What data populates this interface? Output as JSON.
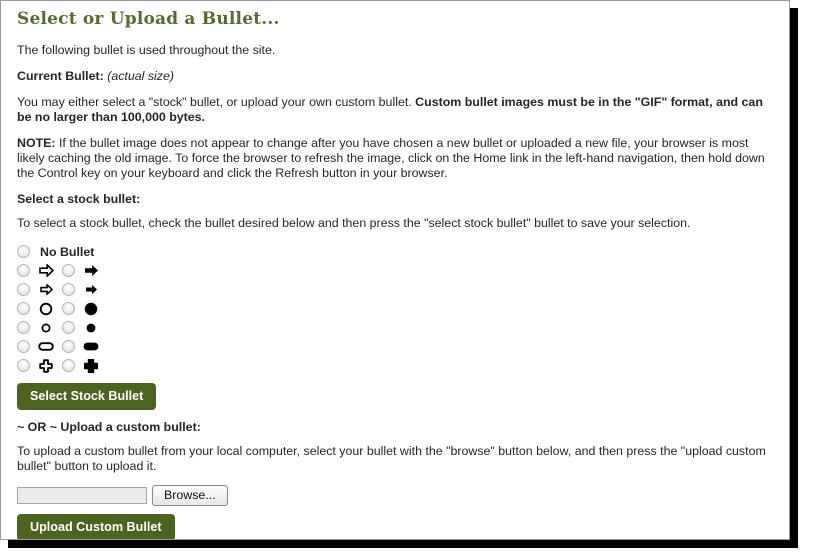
{
  "page": {
    "title": "Select or Upload a Bullet..."
  },
  "intro": {
    "line1": "The following bullet is used throughout the site.",
    "current_bullet_label": "Current Bullet:",
    "current_bullet_note": "(actual size)",
    "upload_info_normal": "You may either select a \"stock\" bullet, or upload your own custom bullet. ",
    "upload_info_bold": "Custom bullet images must be in the \"GIF\" format, and can be no larger than 100,000 bytes.",
    "note_label": "NOTE:",
    "note_body": " If the bullet image does not appear to change after you have chosen a new bullet or uploaded a new file, your browser is most likely caching the old image. To force the browser to refresh the image, click on the Home link in the left-hand navigation, then hold down the Control key on your keyboard and click the Refresh button in your browser."
  },
  "stock": {
    "heading": "Select a stock bullet:",
    "instructions": "To select a stock bullet, check the bullet desired below and then press the \"select stock bullet\" bullet to save your selection.",
    "no_bullet_label": "No Bullet",
    "rows": [
      {
        "left_icon": "arrow-right-outline-icon",
        "right_icon": "arrow-right-solid-icon"
      },
      {
        "left_icon": "arrow-right-outline-small-icon",
        "right_icon": "arrow-right-solid-small-icon"
      },
      {
        "left_icon": "circle-outline-large-icon",
        "right_icon": "circle-solid-large-icon"
      },
      {
        "left_icon": "circle-outline-small-icon",
        "right_icon": "circle-solid-small-icon"
      },
      {
        "left_icon": "rounded-rect-outline-icon",
        "right_icon": "rounded-rect-solid-icon"
      },
      {
        "left_icon": "cross-outline-icon",
        "right_icon": "cross-solid-icon"
      }
    ],
    "select_button_label": "Select Stock Bullet"
  },
  "upload": {
    "heading": "~ OR ~ Upload a custom bullet:",
    "instructions": "To upload a custom bullet from your local computer, select your bullet with the \"browse\" button below, and then press the \"upload custom bullet\" button to upload it.",
    "file_value": "",
    "browse_label": "Browse...",
    "upload_button_label": "Upload Custom Bullet"
  },
  "colors": {
    "title_green": "#556b2f",
    "button_green": "#4c6420",
    "body_text": "#262626"
  }
}
